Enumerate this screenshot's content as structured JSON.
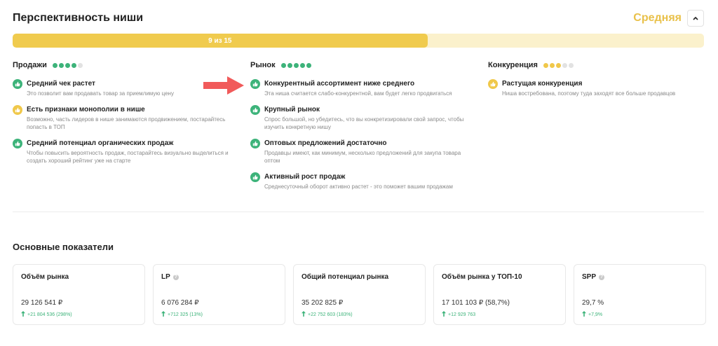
{
  "header": {
    "title": "Перспективность ниши",
    "rating": "Средняя",
    "collapse_icon": "chevron-up-icon"
  },
  "progress": {
    "label": "9 из 15",
    "value": 9,
    "max": 15
  },
  "colors": {
    "green": "#3db37a",
    "yellow": "#f0c84a",
    "gray": "#e2e2e2",
    "red_arrow": "#f15a5a"
  },
  "columns": [
    {
      "title": "Продажи",
      "score": 4,
      "max_score": 5,
      "color": "#3db37a",
      "items": [
        {
          "status": "good",
          "title": "Средний чек растет",
          "desc": "Это позволит вам продавать товар за приемлимую цену"
        },
        {
          "status": "warn",
          "title": "Есть признаки монополии в нише",
          "desc": "Возможно, часть лидеров в нише занимаются продвижением, постарайтесь попасть в ТОП"
        },
        {
          "status": "good",
          "title": "Средний потенциал органических продаж",
          "desc": "Чтобы повысить вероятность продаж, постарайтесь визуально выделиться и создать хороший рейтинг уже на старте"
        }
      ]
    },
    {
      "title": "Рынок",
      "score": 5,
      "max_score": 5,
      "color": "#3db37a",
      "items": [
        {
          "status": "good",
          "title": "Конкурентный ассортимент ниже среднего",
          "desc": "Эта ниша считается слабо-конкурентной, вам будет легко продвигаться"
        },
        {
          "status": "good",
          "title": "Крупный рынок",
          "desc": "Спрос большой, но убедитесь, что вы конкретизировали свой запрос, чтобы изучить конкретную нишу"
        },
        {
          "status": "good",
          "title": "Оптовых предложений достаточно",
          "desc": "Продавцы имеют, как минимум, несколько предложений для закупа товара оптом"
        },
        {
          "status": "good",
          "title": "Активный рост продаж",
          "desc": "Среднесуточный оборот активно растет - это поможет вашим продажам"
        }
      ]
    },
    {
      "title": "Конкуренция",
      "score": 3,
      "max_score": 5,
      "color": "#f0c84a",
      "items": [
        {
          "status": "warn",
          "title": "Растущая конкуренция",
          "desc": "Ниша востребована, поэтому туда заходят все больше продавцов"
        }
      ]
    }
  ],
  "metrics": {
    "title": "Основные показатели",
    "cards": [
      {
        "title": "Объём рынка",
        "info": false,
        "value": "29 126 541 ₽",
        "delta": "+21 804 536 (298%)"
      },
      {
        "title": "LP",
        "info": true,
        "value": "6 076 284 ₽",
        "delta": "+712 325 (13%)"
      },
      {
        "title": "Общий потенциал рынка",
        "info": false,
        "value": "35 202 825 ₽",
        "delta": "+22 752 603 (183%)"
      },
      {
        "title": "Объём рынка у ТОП-10",
        "info": false,
        "value": "17 101 103 ₽  (58,7%)",
        "delta": "+12 929 763"
      },
      {
        "title": "SPP",
        "info": true,
        "value": "29,7 %",
        "delta": "+7,9%"
      }
    ]
  }
}
